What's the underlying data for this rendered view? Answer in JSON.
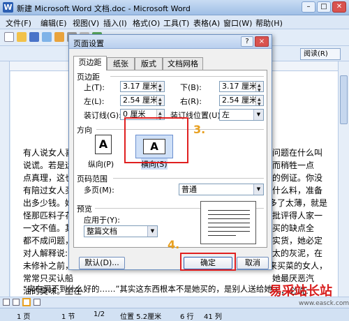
{
  "window": {
    "title": "新建 Microsoft Word 文档.doc - Microsoft Word",
    "icon": "W"
  },
  "menubar": [
    "文件(F)",
    "编辑(E)",
    "视图(V)",
    "插入(I)",
    "格式(O)",
    "工具(T)",
    "表格(A)",
    "窗口(W)",
    "帮助(H)"
  ],
  "toolbar": {
    "read_label": "阅读(R)"
  },
  "document": {
    "lines": [
      "有人说女人喜",
      "说谎。若是运",
      "点真理，这也",
      "有陪过女人买",
      "出多少钱。她",
      "怪那匹料子花",
      "一文不值。其实",
      "都不成问题，",
      "对人解释说:",
      "未修补之前，",
      "常常只买认船",
      "油的臭味。坐在",
      "“实在买不到什么好的……”其实这东西根本不是她买的，是别人送给她"
    ],
    "lines_right": [
      "问题在什么叫",
      "而稍牲一点",
      "的例证。你没",
      "什么料，准备",
      "多了太薄，就是",
      "批评得人家一",
      "买的缺点全",
      "实货，她必定",
      "太的灰泥，在",
      "来买菜的女人，",
      "她最厌恶汽",
      "人，必说:"
    ]
  },
  "statusbar": {
    "page": "1 页",
    "section": "1 节",
    "pages": "1/2",
    "position": "位置 5.2厘米",
    "line": "6 行",
    "col": "41 列"
  },
  "dialog": {
    "title": "页面设置",
    "help": "?",
    "close": "×",
    "tabs": [
      "页边距",
      "纸张",
      "版式",
      "文档网格"
    ],
    "margins_group": "页边距",
    "top_label": "上(T):",
    "top_value": "3.17 厘米",
    "bottom_label": "下(B):",
    "bottom_value": "3.17 厘米",
    "left_label": "左(L):",
    "left_value": "2.54 厘米",
    "right_label": "右(R):",
    "right_value": "2.54 厘米",
    "gutter_label": "装订线(G):",
    "gutter_value": "0 厘米",
    "gutter_pos_label": "装订线位置(U):",
    "gutter_pos_value": "左",
    "orientation_group": "方向",
    "portrait_label": "纵向(P)",
    "landscape_label": "横向(S)",
    "portrait_glyph": "A",
    "landscape_glyph": "A",
    "pages_group": "页码范围",
    "multi_page_label": "多页(M):",
    "multi_page_value": "普通",
    "preview_group": "预览",
    "apply_label": "应用于(Y):",
    "apply_value": "整篇文档",
    "default_button": "默认(D)...",
    "ok_button": "确定",
    "cancel_button": "取消"
  },
  "annotations": {
    "step3": "3.",
    "step4": "4."
  },
  "watermark": {
    "text": "易采站长站",
    "url": "www.easck.com"
  }
}
